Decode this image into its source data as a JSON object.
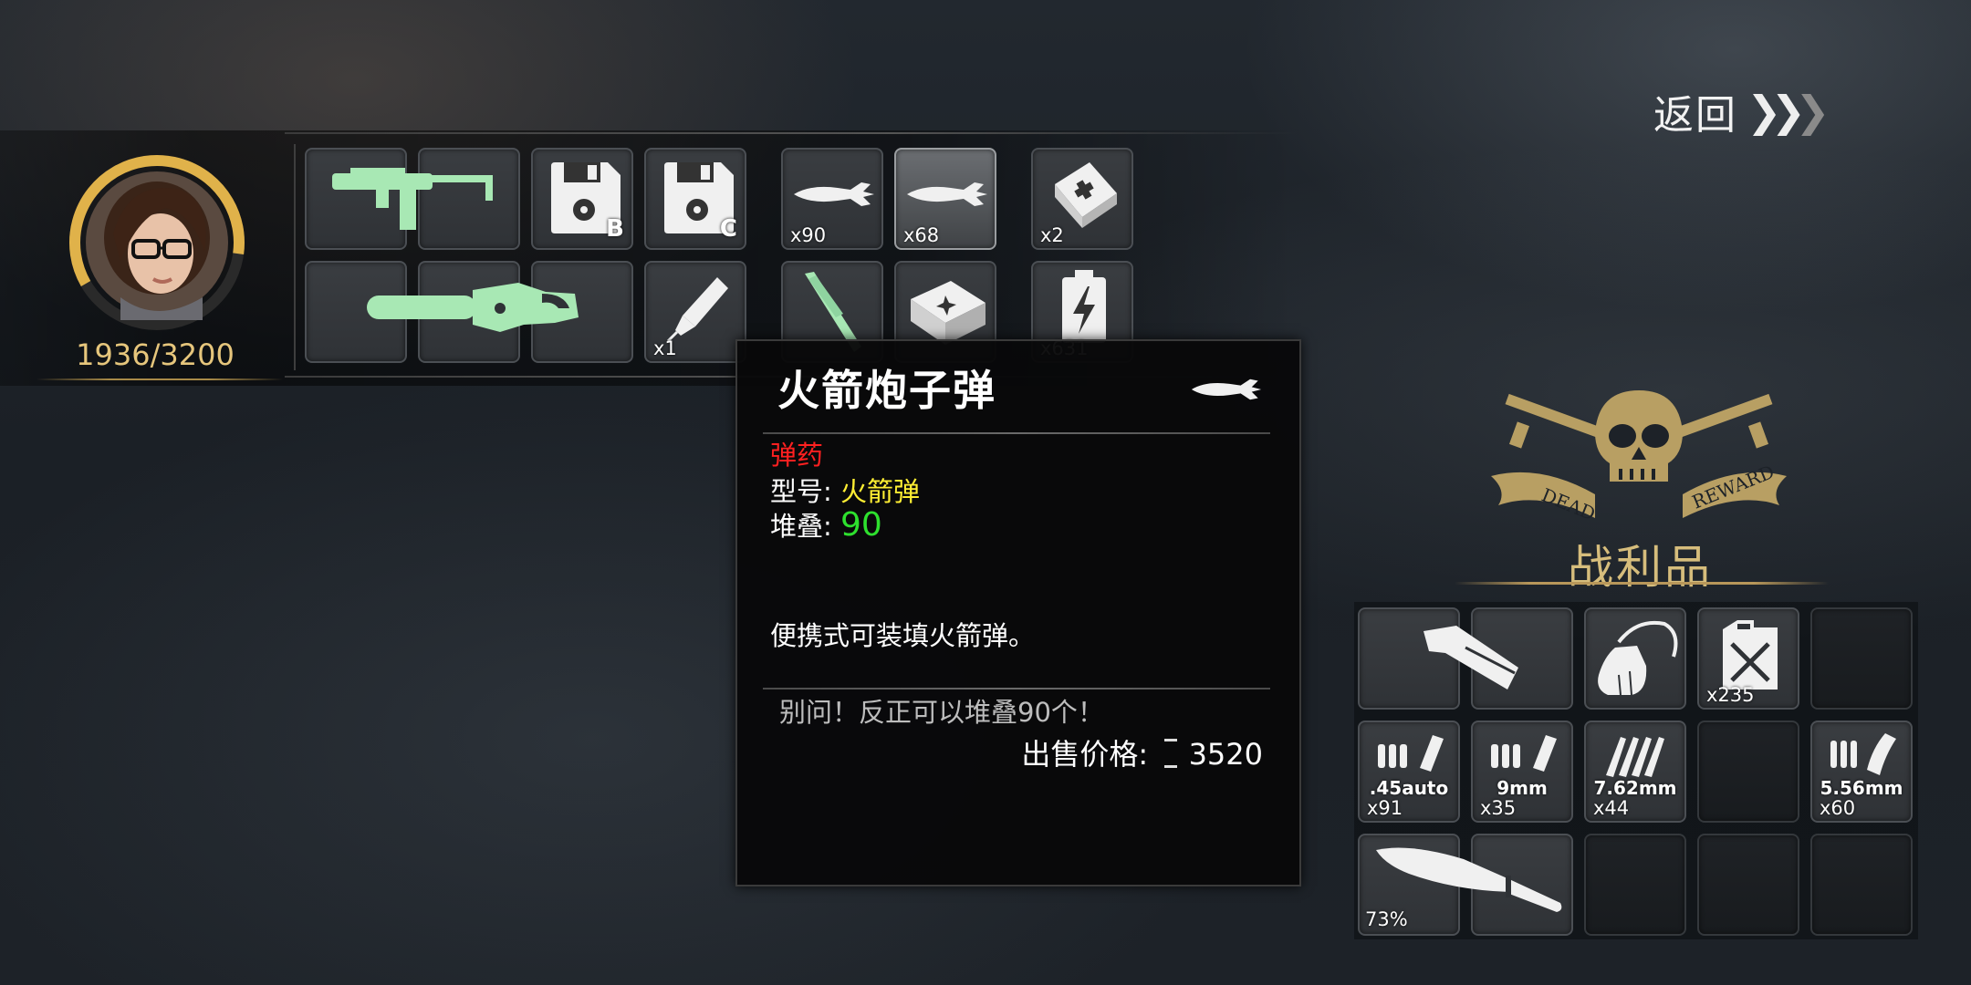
{
  "header": {
    "back_label": "返回"
  },
  "player": {
    "hp_text": "1936/3200",
    "hp_fraction": 0.605
  },
  "inventory": {
    "slot_b_badge": "B",
    "slot_c_badge": "C",
    "syringe_count": "x1",
    "rocket_ammo_1_count": "x90",
    "rocket_ammo_2_count": "x68",
    "medkit_count": "x2",
    "battery_count": "x631"
  },
  "tooltip": {
    "title": "火箭炮子弹",
    "category": "弹药",
    "type_label": "型号:",
    "type_value": "火箭弹",
    "stack_label": "堆叠:",
    "stack_value": "90",
    "description": "便携式可装填火箭弹。",
    "flavor": "别问！反正可以堆叠90个！",
    "price_label": "出售价格:",
    "price_value": "3520"
  },
  "loot": {
    "emblem_left": "DEAD",
    "emblem_right": "REWARD",
    "title": "战利品",
    "fuel_count": "x235",
    "ammo_45": {
      "label": ".45auto",
      "count": "x91"
    },
    "ammo_9mm": {
      "label": "9mm",
      "count": "x35"
    },
    "ammo_762": {
      "label": "7.62mm",
      "count": "x44"
    },
    "ammo_556": {
      "label": "5.56mm",
      "count": "x60"
    },
    "machete_durability": "73%"
  },
  "colors": {
    "weapon_green": "#a8e8b4",
    "hp_gold": "#e6c67c",
    "category_red": "#ff2020",
    "type_yellow": "#ffee33",
    "stack_green": "#2ee02e"
  }
}
